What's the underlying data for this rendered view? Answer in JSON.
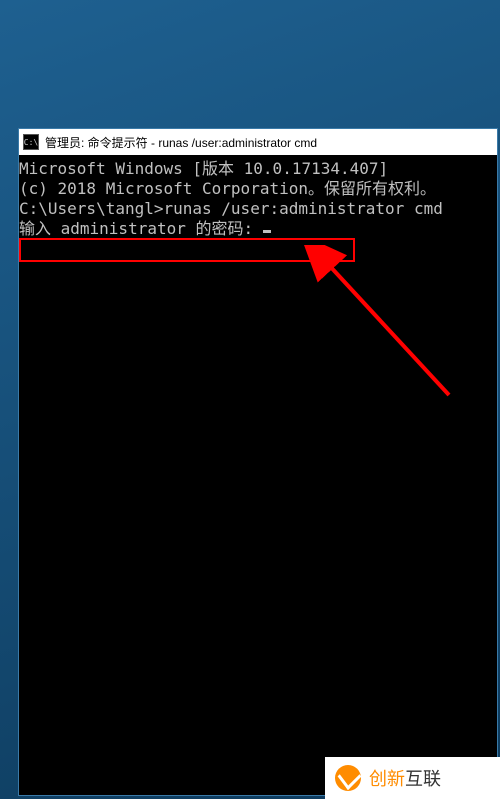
{
  "window": {
    "title": "管理员: 命令提示符 - runas  /user:administrator cmd",
    "icon_label": "C:\\"
  },
  "console": {
    "lines": [
      "Microsoft Windows [版本 10.0.17134.407]",
      "(c) 2018 Microsoft Corporation。保留所有权利。",
      "",
      "C:\\Users\\tangl>runas /user:administrator cmd",
      "输入 administrator 的密码: "
    ]
  },
  "watermark": {
    "brand_prefix": "创新",
    "brand_suffix": "互联"
  }
}
